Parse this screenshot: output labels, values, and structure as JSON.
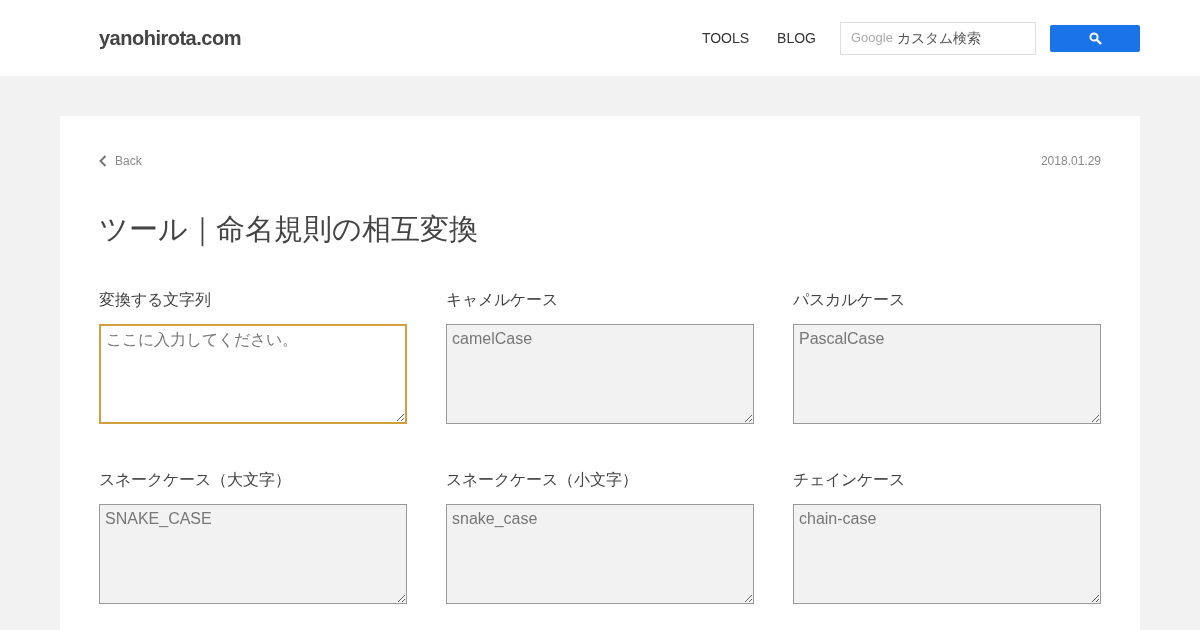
{
  "header": {
    "logo": "yanohirota.com",
    "nav": [
      {
        "label": "TOOLS"
      },
      {
        "label": "BLOG"
      }
    ],
    "search": {
      "brand": "Google",
      "placeholder": "カスタム検索"
    }
  },
  "article": {
    "back": "Back",
    "date": "2018.01.29",
    "title": "ツール｜命名規則の相互変換",
    "fields": [
      {
        "label": "変換する文字列",
        "placeholder": "ここに入力してください。",
        "focused": true,
        "readonly": false
      },
      {
        "label": "キャメルケース",
        "placeholder": "camelCase",
        "focused": false,
        "readonly": true
      },
      {
        "label": "パスカルケース",
        "placeholder": "PascalCase",
        "focused": false,
        "readonly": true
      },
      {
        "label": "スネークケース（大文字）",
        "placeholder": "SNAKE_CASE",
        "focused": false,
        "readonly": true
      },
      {
        "label": "スネークケース（小文字）",
        "placeholder": "snake_case",
        "focused": false,
        "readonly": true
      },
      {
        "label": "チェインケース",
        "placeholder": "chain-case",
        "focused": false,
        "readonly": true
      }
    ]
  }
}
